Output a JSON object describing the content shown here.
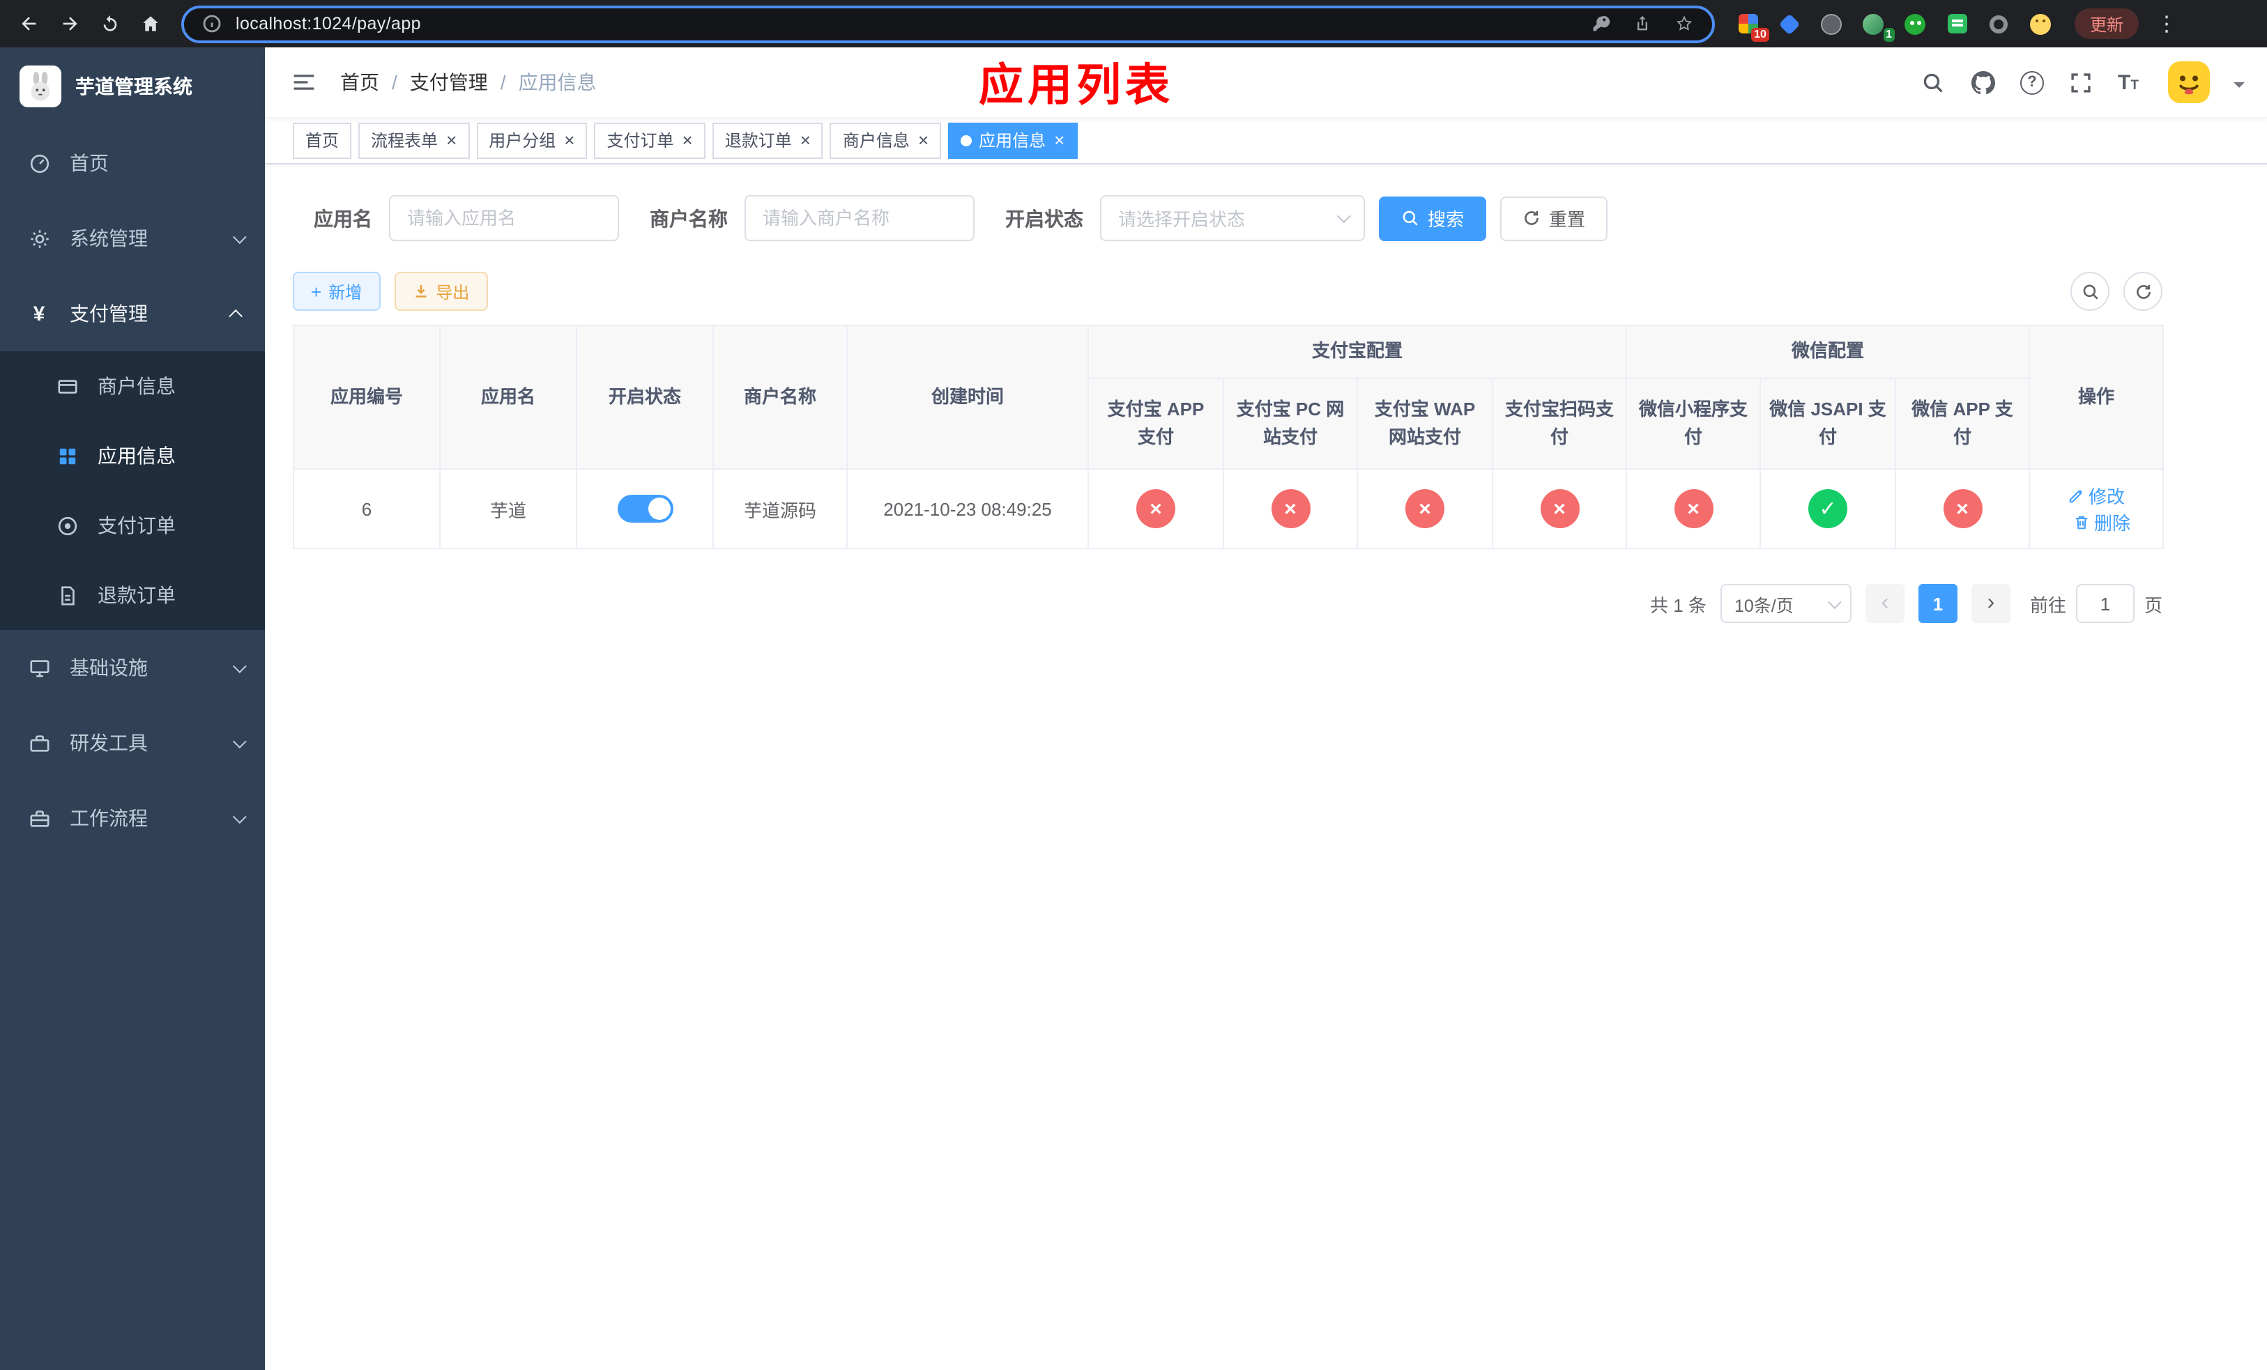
{
  "browser": {
    "url": "localhost:1024/pay/app",
    "update_label": "更新",
    "extension_badges": {
      "first": "10",
      "fourth": "1"
    }
  },
  "icons": {
    "close": "×",
    "plus": "+",
    "kebab": "⋮",
    "check": "✓",
    "cross": "×",
    "prev": "‹",
    "next": "›",
    "yuan": "¥",
    "slash": "/",
    "question": "?",
    "font_large": "T",
    "font_small": "T"
  },
  "sidebar": {
    "title": "芋道管理系统",
    "items": [
      {
        "label": "首页"
      },
      {
        "label": "系统管理"
      },
      {
        "label": "支付管理"
      },
      {
        "label": "基础设施"
      },
      {
        "label": "研发工具"
      },
      {
        "label": "工作流程"
      }
    ],
    "payment_children": [
      {
        "label": "商户信息"
      },
      {
        "label": "应用信息"
      },
      {
        "label": "支付订单"
      },
      {
        "label": "退款订单"
      }
    ]
  },
  "header": {
    "breadcrumb": [
      {
        "label": "首页"
      },
      {
        "label": "支付管理"
      },
      {
        "label": "应用信息"
      }
    ],
    "annotation": "应用列表"
  },
  "tabs": [
    {
      "label": "首页",
      "closable": false,
      "active": false
    },
    {
      "label": "流程表单",
      "closable": true,
      "active": false
    },
    {
      "label": "用户分组",
      "closable": true,
      "active": false
    },
    {
      "label": "支付订单",
      "closable": true,
      "active": false
    },
    {
      "label": "退款订单",
      "closable": true,
      "active": false
    },
    {
      "label": "商户信息",
      "closable": true,
      "active": false
    },
    {
      "label": "应用信息",
      "closable": true,
      "active": true
    }
  ],
  "filters": {
    "app_name_label": "应用名",
    "app_name_placeholder": "请输入应用名",
    "merchant_label": "商户名称",
    "merchant_placeholder": "请输入商户名称",
    "status_label": "开启状态",
    "status_placeholder": "请选择开启状态",
    "search_label": "搜索",
    "reset_label": "重置"
  },
  "toolbar": {
    "add_label": "新增",
    "export_label": "导出"
  },
  "table": {
    "columns": {
      "app_id": "应用编号",
      "app_name": "应用名",
      "status": "开启状态",
      "merchant_name": "商户名称",
      "create_time": "创建时间",
      "alipay_group": "支付宝配置",
      "alipay_app": "支付宝 APP 支付",
      "alipay_pc": "支付宝 PC 网站支付",
      "alipay_wap": "支付宝 WAP 网站支付",
      "alipay_qr": "支付宝扫码支付",
      "wechat_group": "微信配置",
      "wechat_mini": "微信小程序支付",
      "wechat_jsapi": "微信 JSAPI 支付",
      "wechat_app": "微信 APP 支付",
      "actions": "操作"
    },
    "row": {
      "app_id": "6",
      "app_name": "芋道",
      "status_on": true,
      "merchant_name": "芋道源码",
      "create_time": "2021-10-23 08:49:25",
      "pay_configs": [
        false,
        false,
        false,
        false,
        false,
        true,
        false
      ],
      "edit_label": "修改",
      "delete_label": "删除"
    }
  },
  "pagination": {
    "total_text": "共 1 条",
    "page_size_text": "10条/页",
    "current_page": "1",
    "goto_prefix": "前往",
    "goto_value": "1",
    "goto_suffix": "页"
  },
  "colors": {
    "accent_blue": "#409eff",
    "danger_red": "#f56c6c",
    "success_green": "#13ce66",
    "annotation_red": "#ff0000",
    "sidebar_bg": "#304156",
    "submenu_bg": "#1f2d3d"
  }
}
